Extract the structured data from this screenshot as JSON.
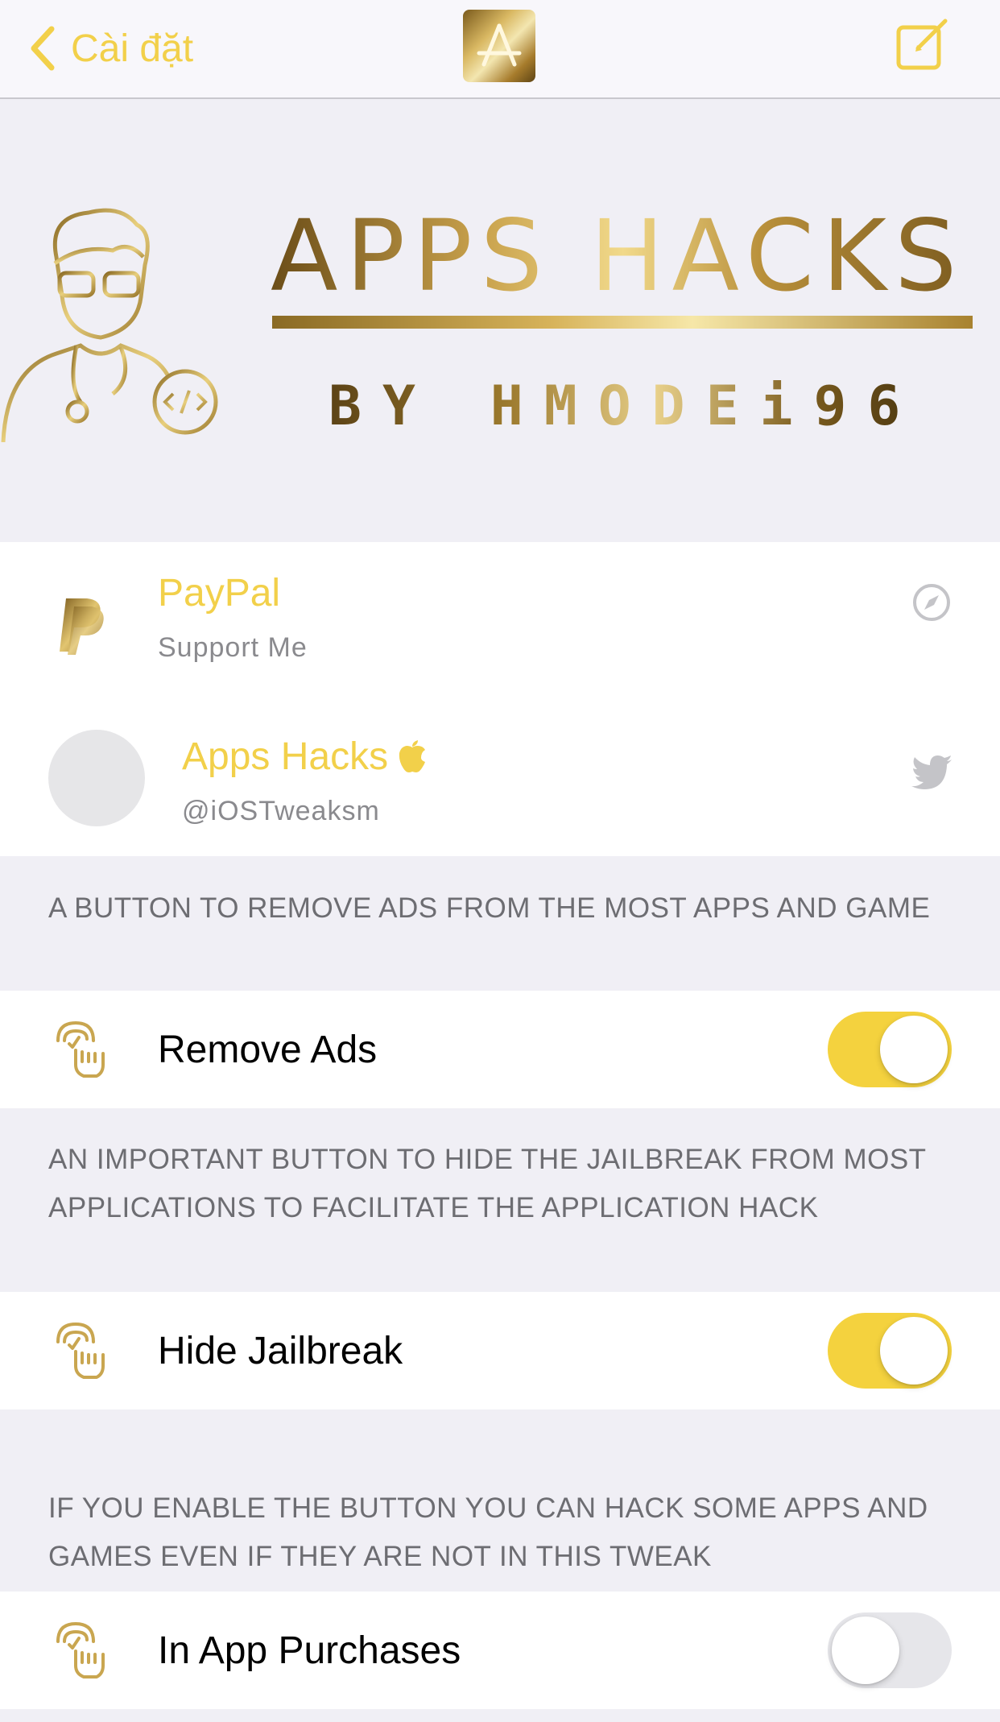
{
  "nav": {
    "back_label": "Cài đặt",
    "back_icon": "chevron-left-icon",
    "logo_icon": "app-store-icon",
    "compose_icon": "compose-icon"
  },
  "banner": {
    "title": "APPS HACKS",
    "subtitle": "BY HMODEi96"
  },
  "links": [
    {
      "title": "PayPal",
      "subtitle": "Support Me",
      "icon": "paypal-icon",
      "accessory": "safari-compass-icon"
    },
    {
      "title": "Apps Hacks",
      "subtitle": "@iOSTweaksm",
      "icon": "avatar",
      "badge": "apple-icon",
      "accessory": "twitter-icon"
    }
  ],
  "sections": [
    {
      "header": "A BUTTON TO REMOVE ADS FROM THE MOST APPS AND GAME",
      "label": "Remove Ads",
      "enabled": true
    },
    {
      "header": "AN IMPORTANT BUTTON TO HIDE THE JAILBREAK FROM MOST APPLICATIONS TO FACILITATE THE APPLICATION HACK",
      "label": "Hide Jailbreak",
      "enabled": true
    },
    {
      "header": "IF YOU ENABLE THE BUTTON YOU CAN HACK SOME APPS AND GAMES EVEN IF THEY ARE NOT IN THIS TWEAK",
      "label": "In App Purchases",
      "enabled": false
    }
  ],
  "colors": {
    "accent": "#f2d04a",
    "switch_on": "#f4d23e",
    "gold": "#b08d3c",
    "background": "#f0eff5"
  }
}
